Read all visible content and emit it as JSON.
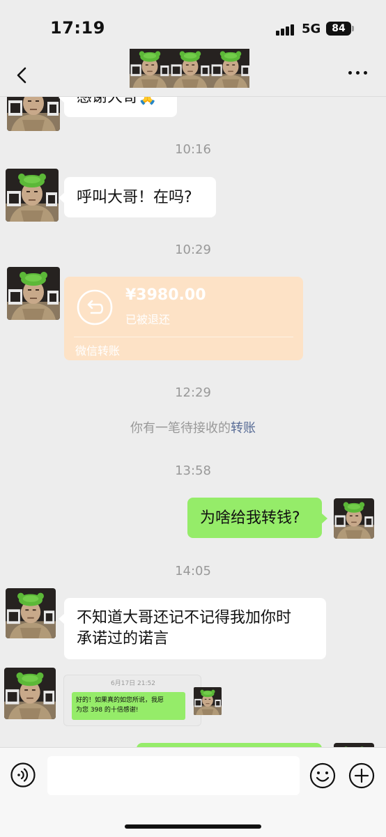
{
  "status_bar": {
    "time": "17:19",
    "network": "5G",
    "battery": "84"
  },
  "nav": {
    "back_icon": "chevron-left-icon",
    "more_icon": "ellipsis-icon"
  },
  "messages": {
    "m0_partial": "感谢大哥🙏",
    "ts1": "10:16",
    "m1": "呼叫大哥！在吗?",
    "ts2": "10:29",
    "transfer": {
      "amount": "¥3980.00",
      "status": "已被退还",
      "footer": "微信转账",
      "color": "#fde2c6"
    },
    "ts3": "12:29",
    "system_text": "你有一笔待接收的",
    "system_link": "转账",
    "ts4": "13:58",
    "m2": "为啥给我转钱?",
    "ts5": "14:05",
    "m3_line1": "不知道大哥还记不记得我加你时",
    "m3_line2": "承诺过的诺言",
    "quote": {
      "date": "6月17日 21:52",
      "text_line1": "好的！如果真的如您所说，我愿",
      "text_line2": "为您 398 的十倍感谢!"
    }
  },
  "input_bar": {
    "voice_icon": "voice-icon",
    "emoji_icon": "emoji-icon",
    "plus_icon": "plus-icon"
  },
  "colors": {
    "background": "#ededed",
    "bubble_right": "#95ec69",
    "bubble_left": "#ffffff",
    "link": "#576b95"
  }
}
